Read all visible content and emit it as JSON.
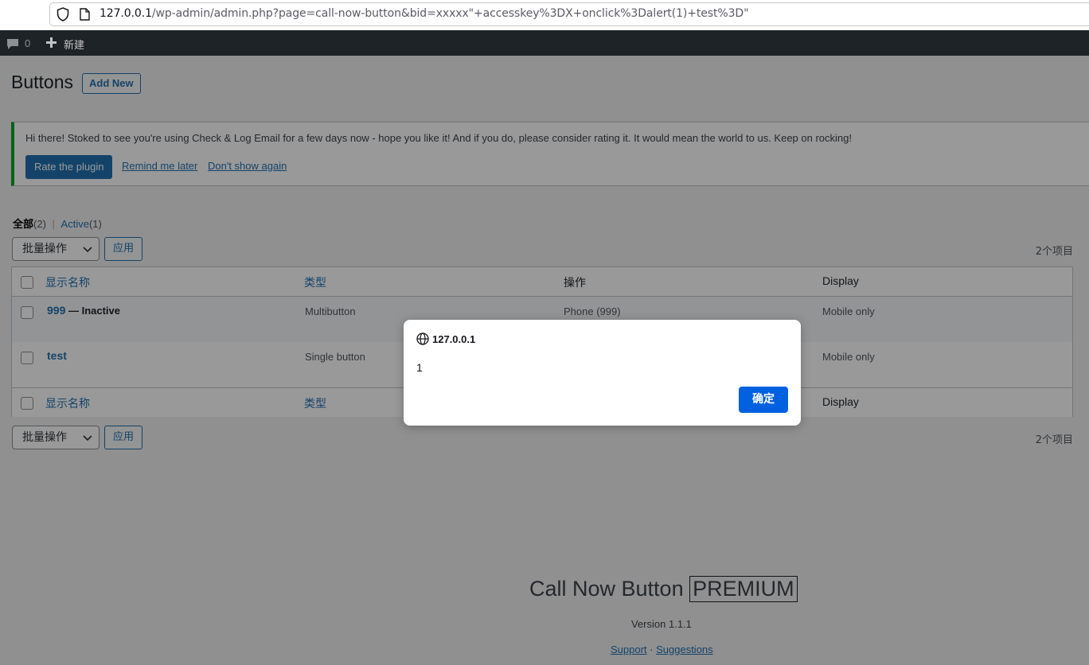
{
  "browser": {
    "url_host": "127.0.0.1",
    "url_path": "/wp-admin/admin.php?page=call-now-button&bid=xxxxx\"+accesskey%3DX+onclick%3Dalert(1)+test%3D\""
  },
  "adminbar": {
    "comment_count": "0",
    "new_label": "新建"
  },
  "page": {
    "title": "Buttons",
    "add_new": "Add New"
  },
  "notice": {
    "text": "Hi there! Stoked to see you're using Check & Log Email for a few days now - hope you like it! And if you do, please consider rating it. It would mean the world to us. Keep on rocking!",
    "rate": "Rate the plugin",
    "remind": "Remind me later",
    "dont_show": "Don't show again",
    "accent": "#00a32a"
  },
  "views": {
    "all_label": "全部",
    "all_count": "(2)",
    "separator": "|",
    "active_label": "Active",
    "active_count": "(1)"
  },
  "bulk": {
    "select_label": "批量操作",
    "apply": "应用",
    "items_count": "2个项目"
  },
  "table": {
    "columns": [
      "显示名称",
      "类型",
      "操作",
      "Display"
    ],
    "rows": [
      {
        "name": "999",
        "state": " — Inactive",
        "type": "Multibutton",
        "action": "Phone (999)",
        "display": "Mobile only"
      },
      {
        "name": "test",
        "state": "",
        "type": "Single button",
        "action": "",
        "display": "Mobile only"
      }
    ]
  },
  "footer": {
    "brand": "Call Now Button",
    "premium": "PREMIUM",
    "version": "Version 1.1.1",
    "support": "Support",
    "dot": " · ",
    "suggestions": "Suggestions"
  },
  "dialog": {
    "origin": "127.0.0.1",
    "message": "1",
    "ok": "确定",
    "ok_color": "#0061e0"
  }
}
